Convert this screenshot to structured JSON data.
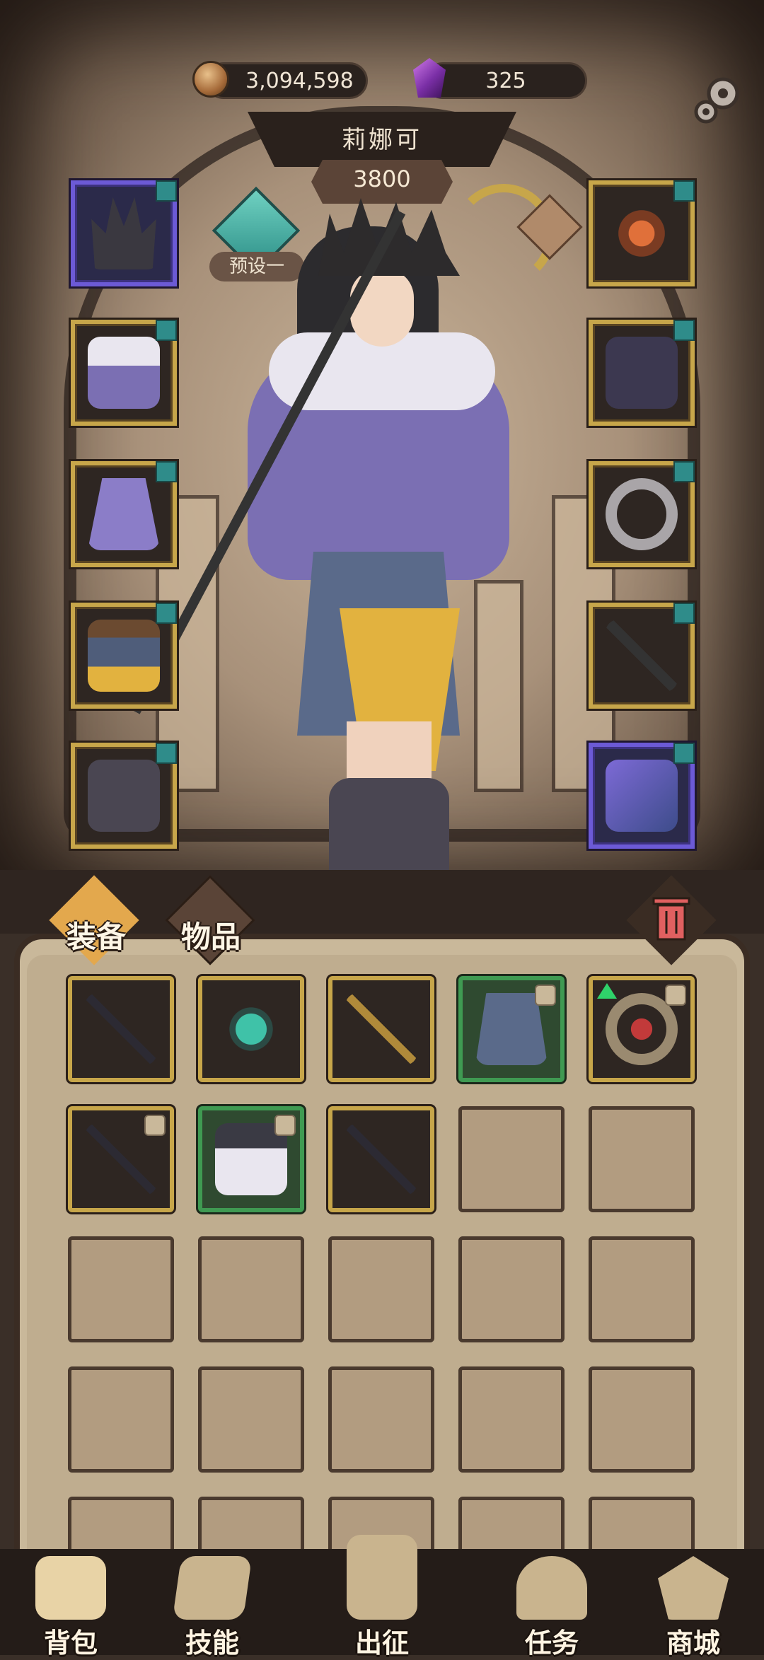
{
  "currency": {
    "coins": "3,094,598",
    "gems": "325"
  },
  "character": {
    "name": "莉娜可",
    "power": "3800",
    "preset_label": "预设一"
  },
  "equipment_left": [
    {
      "name": "crown-helm",
      "rarity": "purple"
    },
    {
      "name": "fur-coat",
      "rarity": "gold"
    },
    {
      "name": "butterfly-cloak",
      "rarity": "gold"
    },
    {
      "name": "belt-skirt",
      "rarity": "gold"
    },
    {
      "name": "boots",
      "rarity": "gold"
    }
  ],
  "equipment_right": [
    {
      "name": "amulet",
      "rarity": "gold"
    },
    {
      "name": "claw-gauntlet",
      "rarity": "gold"
    },
    {
      "name": "ring",
      "rarity": "gold"
    },
    {
      "name": "scythe-staff",
      "rarity": "gold"
    },
    {
      "name": "spellbook",
      "rarity": "purple"
    }
  ],
  "tabs": {
    "equipment": "装备",
    "items": "物品"
  },
  "inventory": [
    {
      "rarity": "gold",
      "locked": false,
      "upgrade": false
    },
    {
      "rarity": "gold",
      "locked": false,
      "upgrade": false
    },
    {
      "rarity": "gold",
      "locked": false,
      "upgrade": false
    },
    {
      "rarity": "green",
      "locked": true,
      "upgrade": false
    },
    {
      "rarity": "gold",
      "locked": true,
      "upgrade": true
    },
    {
      "rarity": "gold",
      "locked": true,
      "upgrade": false
    },
    {
      "rarity": "green",
      "locked": true,
      "upgrade": false
    },
    {
      "rarity": "gold",
      "locked": false,
      "upgrade": false
    }
  ],
  "bottom_nav": {
    "bag": "背包",
    "skills": "技能",
    "expedition": "出征",
    "quests": "任务",
    "shop": "商城"
  },
  "colors": {
    "gold_frame": "#c7a64a",
    "purple_frame": "#6c5ad6",
    "green_frame": "#3f9a52",
    "tag": "#2f8c8a"
  }
}
